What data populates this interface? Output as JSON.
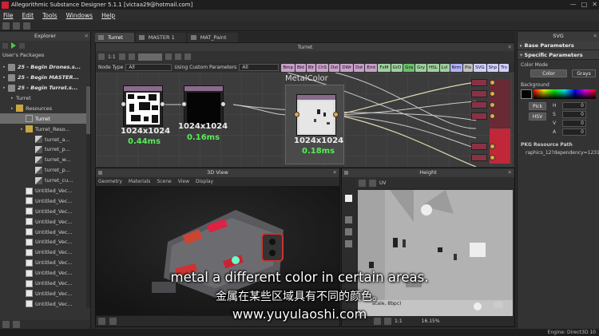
{
  "window": {
    "title": "Allegorithmic Substance Designer 5.1.1 [victaa29@hotmail.com]",
    "controls": [
      "—",
      "□",
      "✕"
    ]
  },
  "menu": [
    "File",
    "Edit",
    "Tools",
    "Windows",
    "Help"
  ],
  "explorer": {
    "title": "Explorer",
    "root_label": "User's Packages",
    "items": [
      {
        "label": "25 - Begin Drones.s...",
        "kind": "pkg",
        "bold": true
      },
      {
        "label": "25 - Begin MASTER...",
        "kind": "pkg",
        "bold": true
      },
      {
        "label": "25 - Begin Turret.s...",
        "kind": "pkg",
        "bold": true
      },
      {
        "label": "Turret",
        "kind": "graph"
      },
      {
        "label": "Resources",
        "kind": "folder"
      },
      {
        "label": "Turret",
        "kind": "res",
        "selected": true
      },
      {
        "label": "Turret_Reso...",
        "kind": "folder"
      },
      {
        "label": "turret_a...",
        "kind": "tex"
      },
      {
        "label": "turret_p...",
        "kind": "tex"
      },
      {
        "label": "turret_w...",
        "kind": "tex"
      },
      {
        "label": "turret_p...",
        "kind": "tex"
      },
      {
        "label": "turret_cu...",
        "kind": "tex"
      },
      {
        "label": "Untitled_Vec...",
        "kind": "vec"
      },
      {
        "label": "Untitled_Vec...",
        "kind": "vec"
      },
      {
        "label": "Untitled_Vec...",
        "kind": "vec"
      },
      {
        "label": "Untitled_Vec...",
        "kind": "vec"
      },
      {
        "label": "Untitled_Vec...",
        "kind": "vec"
      },
      {
        "label": "Untitled_Vec...",
        "kind": "vec"
      },
      {
        "label": "Untitled_Vec...",
        "kind": "vec"
      },
      {
        "label": "Untitled_Vec...",
        "kind": "vec"
      },
      {
        "label": "Untitled_Vec...",
        "kind": "vec"
      },
      {
        "label": "Untitled_Vec...",
        "kind": "vec"
      },
      {
        "label": "Untitled_Vec...",
        "kind": "vec"
      },
      {
        "label": "Untitled_Vec...",
        "kind": "vec"
      }
    ]
  },
  "tabs": [
    "Turret",
    "MASTER 1",
    "MAT_Paint"
  ],
  "graph": {
    "title": "Turret",
    "zoom": "1:1",
    "node_type_label": "Node Type",
    "node_type_value": "All",
    "custom_params_label": "Using Custom Parameters",
    "custom_params_value": "All",
    "filter_chips": [
      {
        "label": "Bmp",
        "color": "#c8a0c8"
      },
      {
        "label": "Bld",
        "color": "#c8a0c8"
      },
      {
        "label": "Blr",
        "color": "#c8a0c8"
      },
      {
        "label": "ChS",
        "color": "#c8a0c8"
      },
      {
        "label": "Dst",
        "color": "#c8a0c8"
      },
      {
        "label": "DWr",
        "color": "#c8a0c8"
      },
      {
        "label": "Dst",
        "color": "#c8a0c8"
      },
      {
        "label": "Emt",
        "color": "#c8a0c8"
      },
      {
        "label": "FxM",
        "color": "#9fd09f"
      },
      {
        "label": "GrD",
        "color": "#9fd09f"
      },
      {
        "label": "Gra",
        "color": "#6cbf6c"
      },
      {
        "label": "Gry",
        "color": "#9fd09f"
      },
      {
        "label": "HSL",
        "color": "#9fd09f"
      },
      {
        "label": "Lvl",
        "color": "#9fd09f"
      },
      {
        "label": "Nrm",
        "color": "#b0b0ff"
      },
      {
        "label": "Pix",
        "color": "#c0c0c0"
      },
      {
        "label": "SVG",
        "color": "#d0d0ff"
      },
      {
        "label": "Shp",
        "color": "#d0d0ff"
      },
      {
        "label": "Trs",
        "color": "#d0d0ff"
      }
    ],
    "frame_label": "MetalColor",
    "nodes": [
      {
        "resolution": "1024x1024",
        "time": "0.44ms"
      },
      {
        "resolution": "1024x1024",
        "time": "0.16ms"
      },
      {
        "resolution": "1024x1024",
        "time": "0.18ms"
      }
    ]
  },
  "view3d": {
    "title": "3D View",
    "menu": [
      "Geometry",
      "Materials",
      "Scene",
      "View",
      "Display"
    ]
  },
  "height_view": {
    "title": "Height",
    "uv_label": "UV",
    "texture_info": "scale, 8bpc)",
    "zoom_ratio": "1:1",
    "zoom_percent": "16.15%"
  },
  "right_panel": {
    "title": "SVG",
    "sections": {
      "base": "Base Parameters",
      "specific": "Specific Parameters"
    },
    "color_mode_label": "Color Mode",
    "color_mode_buttons": [
      "Color",
      "Grays"
    ],
    "background_label": "Background",
    "pick_label": "Pick",
    "hsv_label": "HSV",
    "channels": [
      {
        "name": "H",
        "value": "0"
      },
      {
        "name": "S",
        "value": "0"
      },
      {
        "name": "V",
        "value": "0"
      },
      {
        "name": "A",
        "value": "0"
      }
    ],
    "pkg_path_label": "PKG Resource Path",
    "pkg_path_value": "raphics_12?dependency=1231"
  },
  "status": {
    "engine": "Engine: Direct3D 10"
  },
  "subtitles": {
    "line1": "metal a different color in certain areas.",
    "line2": "金属在某些区域具有不同的颜色。",
    "line3": "www.yuyulaoshi.com"
  }
}
